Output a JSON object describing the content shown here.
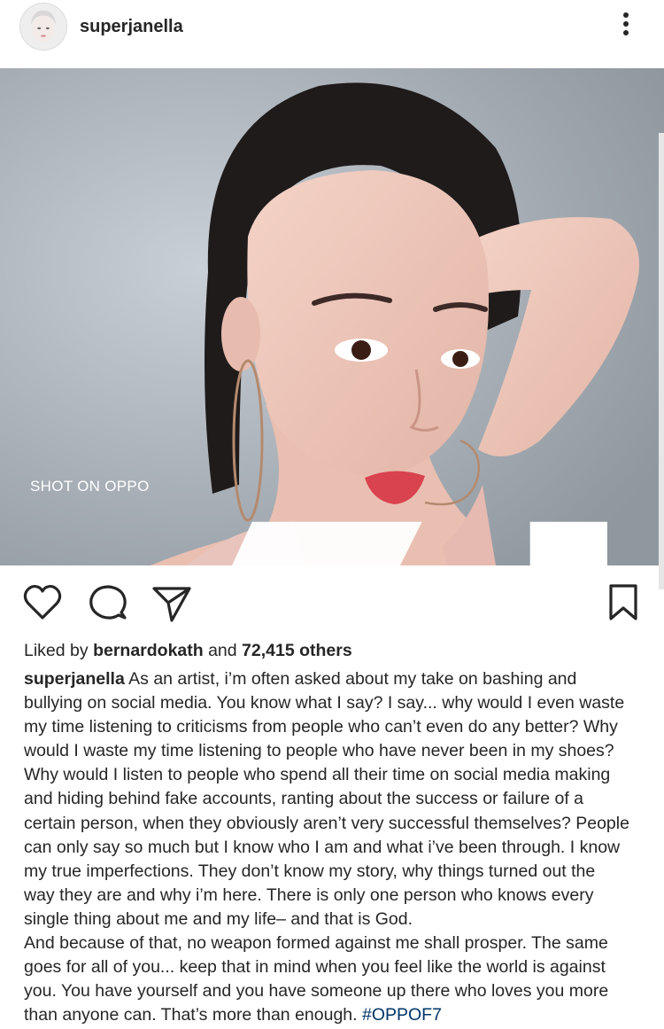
{
  "header": {
    "username": "superjanella",
    "avatar_icon": "profile-avatar",
    "more_icon": "more-vertical-icon"
  },
  "photo": {
    "watermark_text": "SHOT ON OPPO",
    "watermark_icon": "ai-logo-icon"
  },
  "actions": {
    "like_icon": "heart-icon",
    "comment_icon": "comment-icon",
    "share_icon": "paper-plane-icon",
    "save_icon": "bookmark-icon"
  },
  "likes": {
    "prefix": "Liked by ",
    "user": "bernardokath",
    "connector": " and ",
    "count": "72,415 others"
  },
  "caption": {
    "username": "superjanella",
    "first_line_text": " As an artist, i’m often asked about my take on bashing and",
    "lines": [
      "bullying on social media. You know what I say? I say... why would I even waste",
      "my time listening to criticisms from people who can’t even do any better? Why",
      "would I waste my time listening to people who have never been in my shoes?",
      "Why would I listen to people who spend all their time on social media making",
      "and hiding behind fake accounts, ranting about the success or failure of a",
      "certain person, when they obviously aren’t very successful themselves? People",
      "can only say so much but I know who I am and what i’ve been through. I know",
      "my true imperfections. They don’t know my story, why things turned out the",
      "way they are and why i’m here. There is only one person who knows every",
      "single thing about me and my life– and that is God.",
      "And because of that, no weapon formed against me shall prosper. The same",
      "goes for all of you... keep that in mind when you feel like the world is against",
      "you. You have yourself and you have someone up there who loves you more"
    ],
    "last_line_text": "than anyone can. That’s more than enough. ",
    "hashtag": "#OPPOF7"
  },
  "colors": {
    "text": "#262626",
    "hashtag": "#003569",
    "border": "#dbdbdb"
  }
}
